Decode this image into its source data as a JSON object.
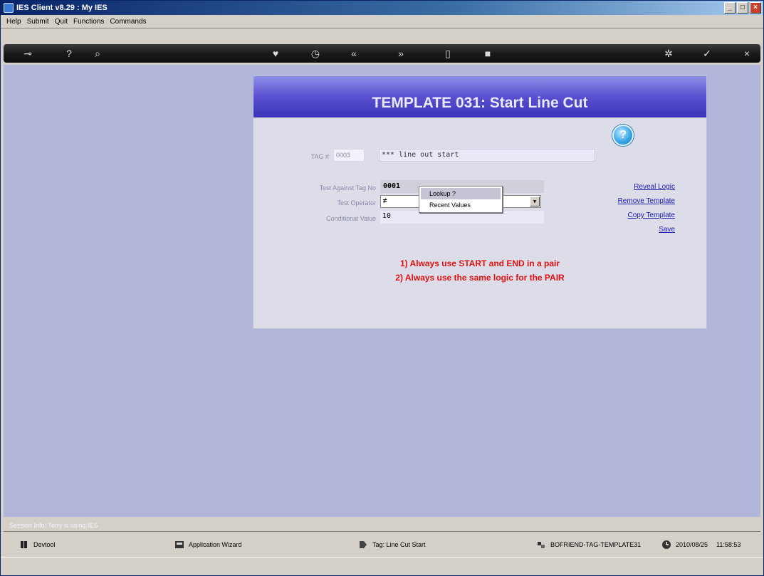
{
  "window": {
    "title": "IES Client v8.29 : My IES",
    "controls": [
      "_",
      "□",
      "×"
    ]
  },
  "menubar": {
    "items": [
      "Help",
      "Submit",
      "Quit",
      "Functions",
      "Commands"
    ]
  },
  "toolbar": {
    "buttons": [
      {
        "icon": "key-icon",
        "glyph": "⊸"
      },
      {
        "icon": "help-icon",
        "glyph": "?"
      },
      {
        "icon": "search-icon",
        "glyph": "⌕"
      },
      {
        "icon": "heart-icon",
        "glyph": "♥"
      },
      {
        "icon": "clock-icon",
        "glyph": "◷"
      },
      {
        "icon": "rewind-icon",
        "glyph": "«"
      },
      {
        "icon": "fast-forward-icon",
        "glyph": "»"
      },
      {
        "icon": "document-icon",
        "glyph": "▯"
      },
      {
        "icon": "stop-icon",
        "glyph": "■"
      },
      {
        "icon": "tools-icon",
        "glyph": "✲"
      },
      {
        "icon": "check-icon",
        "glyph": "✓"
      },
      {
        "icon": "close-icon",
        "glyph": "×"
      }
    ]
  },
  "form": {
    "title": "TEMPLATE 031: Start Line Cut",
    "help_glyph": "?",
    "tag_label": "TAG #",
    "tag_value": "0003",
    "tag_description": "*** line out start",
    "test_tag_label": "Test Against Tag No",
    "test_tag_value": "0001",
    "test_operator_label": "Test Operator",
    "test_operator_value": "≠",
    "test_operator_arrow": "▼",
    "conditional_label": "Conditional Value",
    "conditional_value": "10",
    "popup": {
      "lookup": "Lookup ?",
      "recent": "Recent Values"
    },
    "links": {
      "reveal_logic": "Reveal Logic",
      "remove_template": "Remove Template",
      "copy_template": "Copy Template",
      "save": "Save"
    },
    "notes": [
      "1) Always use START and END in a pair",
      "2) Always use the same logic for the PAIR"
    ]
  },
  "session": {
    "info": "Session Info: Terry is using IES"
  },
  "statusbar": {
    "devtool": "Devtool",
    "app_wizard": "Application Wizard",
    "tag": "Tag: Line Cut Start",
    "module": "BOFRIEND-TAG-TEMPLATE31",
    "date": "2010/08/25",
    "time": "11:58:53"
  }
}
